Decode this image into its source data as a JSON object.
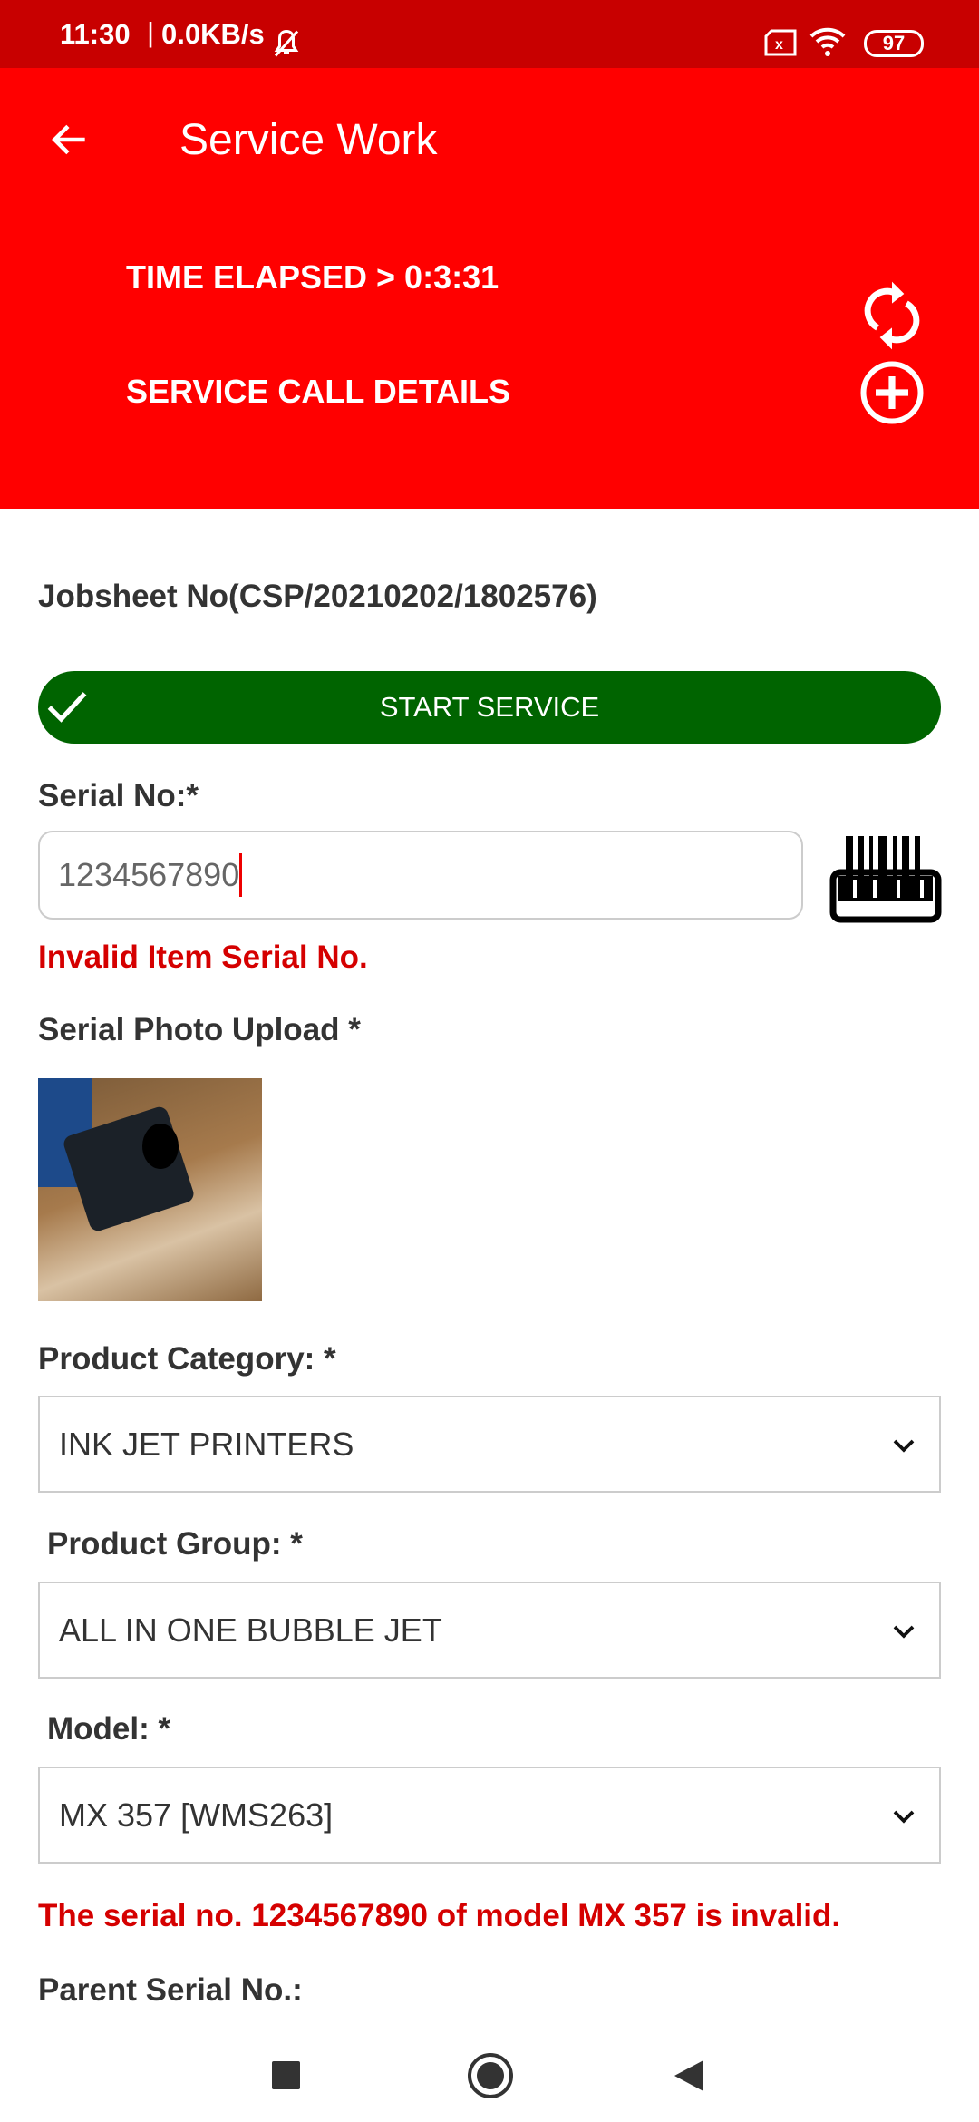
{
  "status_bar": {
    "time": "11:30",
    "speed": "0.0KB/s",
    "battery": "97"
  },
  "header": {
    "title": "Service Work",
    "time_elapsed": "TIME ELAPSED > 0:3:31",
    "service_call_details": "SERVICE CALL DETAILS"
  },
  "form": {
    "jobsheet": "Jobsheet No(CSP/20210202/1802576)",
    "start_service": "START SERVICE",
    "serial_label": "Serial No:*",
    "serial_value": "1234567890",
    "serial_error": "Invalid Item Serial No.",
    "photo_label": "Serial Photo Upload *",
    "category_label": "Product Category: *",
    "category_value": "INK JET PRINTERS",
    "group_label": "Product Group: *",
    "group_value": "ALL IN ONE BUBBLE JET",
    "model_label": "Model: *",
    "model_value": "MX 357 [WMS263]",
    "model_error": "The serial no. 1234567890 of model MX 357 is invalid.",
    "parent_serial_label": "Parent Serial No.:"
  },
  "colors": {
    "header": "#ff0000",
    "status": "#c80000",
    "start_button": "#006400",
    "error": "#d50000"
  }
}
